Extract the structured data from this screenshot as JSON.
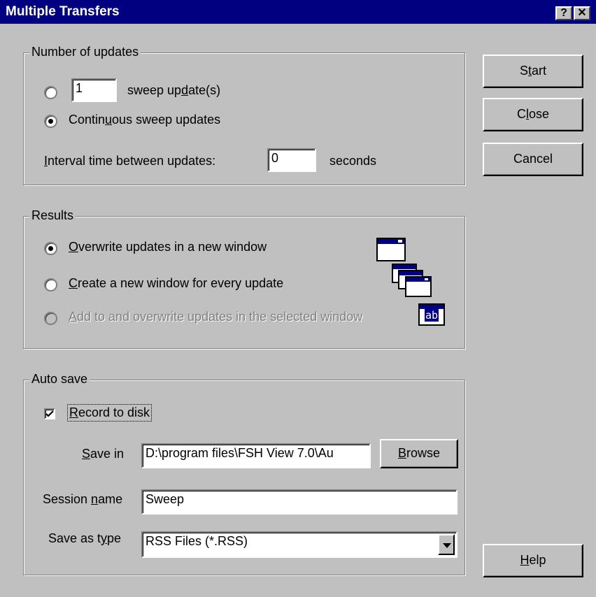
{
  "window": {
    "title": "Multiple Transfers",
    "help_glyph": "?",
    "close_glyph": "✕"
  },
  "updates": {
    "group_label": "Number of updates",
    "sweep_count": "1",
    "sweep_label_a": "sweep up",
    "sweep_label_u": "d",
    "sweep_label_b": "ate(s)",
    "continuous_label_a": "Contin",
    "continuous_label_u": "u",
    "continuous_label_b": "ous sweep updates",
    "selected": "continuous",
    "interval_label_u": "I",
    "interval_label_rest": "nterval time between updates:",
    "interval_value": "0",
    "interval_unit": "seconds"
  },
  "results": {
    "group_label": "Results",
    "overwrite_u": "O",
    "overwrite_rest": "verwrite updates in a new window",
    "create_u": "C",
    "create_rest": "reate a new window for every update",
    "add_u": "A",
    "add_rest": "dd to and overwrite updates in the selected window",
    "selected": "overwrite",
    "add_icon_text": "ab"
  },
  "autosave": {
    "group_label": "Auto save",
    "record_u": "R",
    "record_rest": "ecord to disk",
    "record_checked": true,
    "save_in_u": "S",
    "save_in_rest": "ave in",
    "save_in_value": "D:\\program files\\FSH View 7.0\\Au",
    "browse_u": "B",
    "browse_rest": "rowse",
    "session_a": "Session ",
    "session_u": "n",
    "session_b": "ame",
    "session_value": "Sweep",
    "type_a": "Save as t",
    "type_u": "y",
    "type_b": "pe",
    "type_value": "RSS Files (*.RSS)"
  },
  "buttons": {
    "start_a": "S",
    "start_u": "t",
    "start_b": "art",
    "close_a": "C",
    "close_u": "l",
    "close_b": "ose",
    "cancel": "Cancel",
    "help_u": "H",
    "help_rest": "elp"
  },
  "colors": {
    "titlebar": "#000080",
    "face": "#c0c0c0"
  }
}
